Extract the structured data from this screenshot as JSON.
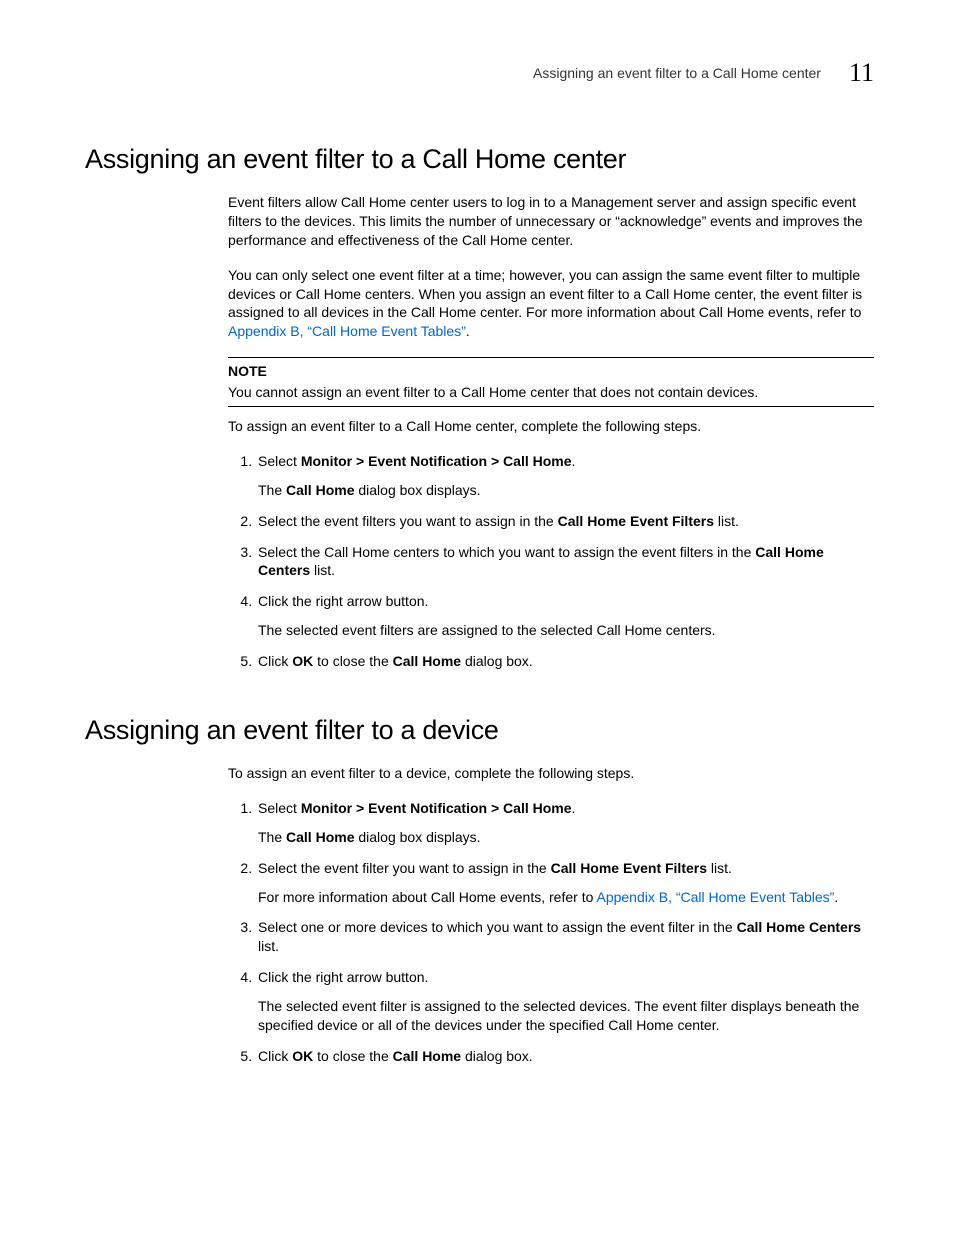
{
  "header": {
    "running_title": "Assigning an event filter to a Call Home center",
    "chapter_number": "11"
  },
  "section1": {
    "title": "Assigning an event filter to a Call Home center",
    "p1": "Event filters allow Call Home center users to log in to a Management server and assign specific event filters to the devices. This limits the number of unnecessary or “acknowledge” events and improves the performance and effectiveness of the Call Home center.",
    "p2a": "You can only select one event filter at a time; however, you can assign the same event filter to multiple devices or Call Home centers. When you assign an event filter to a Call Home center, the event filter is assigned to all devices in the Call Home center. For more information about Call Home events, refer to ",
    "p2_link": "Appendix B, “Call Home Event Tables”",
    "p2b": ".",
    "note_label": "NOTE",
    "note_body": "You cannot assign an event filter to a Call Home center that does not contain devices.",
    "p3": "To assign an event filter to a Call Home center, complete the following steps.",
    "steps": {
      "s1a": "Select ",
      "s1b": "Monitor > Event Notification > Call Home",
      "s1c": ".",
      "s1_sub_a": "The ",
      "s1_sub_b": "Call Home",
      "s1_sub_c": " dialog box displays.",
      "s2a": "Select the event filters you want to assign in the ",
      "s2b": "Call Home Event Filters",
      "s2c": " list.",
      "s3a": "Select the Call Home centers to which you want to assign the event filters in the ",
      "s3b": "Call Home Centers",
      "s3c": " list.",
      "s4": "Click the right arrow button.",
      "s4_sub": "The selected event filters are assigned to the selected Call Home centers.",
      "s5a": "Click ",
      "s5b": "OK",
      "s5c": " to close the ",
      "s5d": "Call Home",
      "s5e": " dialog box."
    }
  },
  "section2": {
    "title": "Assigning an event filter to a device",
    "p1": "To assign an event filter to a device, complete the following steps.",
    "steps": {
      "s1a": "Select ",
      "s1b": "Monitor > Event Notification > Call Home",
      "s1c": ".",
      "s1_sub_a": "The ",
      "s1_sub_b": "Call Home",
      "s1_sub_c": " dialog box displays.",
      "s2a": "Select the event filter you want to assign in the ",
      "s2b": "Call Home Event Filters",
      "s2c": " list.",
      "s2_sub_a": "For more information about Call Home events, refer to ",
      "s2_sub_link": "Appendix B, “Call Home Event Tables”",
      "s2_sub_b": ".",
      "s3a": "Select one or more devices to which you want to assign the event filter in the ",
      "s3b": "Call Home Centers",
      "s3c": " list.",
      "s4": "Click the right arrow button.",
      "s4_sub": "The selected event filter is assigned to the selected devices. The event filter displays beneath the specified device or all of the devices under the specified Call Home center.",
      "s5a": "Click ",
      "s5b": "OK",
      "s5c": " to close the ",
      "s5d": "Call Home",
      "s5e": " dialog box."
    }
  }
}
